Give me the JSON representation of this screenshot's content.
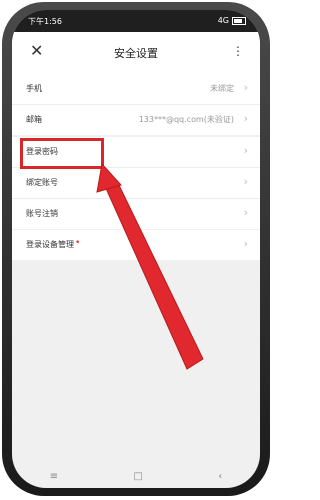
{
  "status": {
    "time": "下午1:56",
    "network": "4G"
  },
  "header": {
    "title": "安全设置",
    "close": "✕",
    "more": "⋮"
  },
  "groups": [
    [
      {
        "label": "手机",
        "value": "未绑定"
      },
      {
        "label": "邮箱",
        "value": "133***@qq.com(未验证)"
      }
    ],
    [
      {
        "label": "登录密码",
        "value": ""
      },
      {
        "label": "绑定账号",
        "value": ""
      },
      {
        "label": "账号注销",
        "value": ""
      }
    ],
    [
      {
        "label": "登录设备管理",
        "value": ""
      }
    ]
  ],
  "arrow": "›",
  "navbar": {
    "menu": "≡",
    "home": "□",
    "back": "‹"
  },
  "colors": {
    "highlight": "#d9262b",
    "arrow": "#e0282e"
  }
}
